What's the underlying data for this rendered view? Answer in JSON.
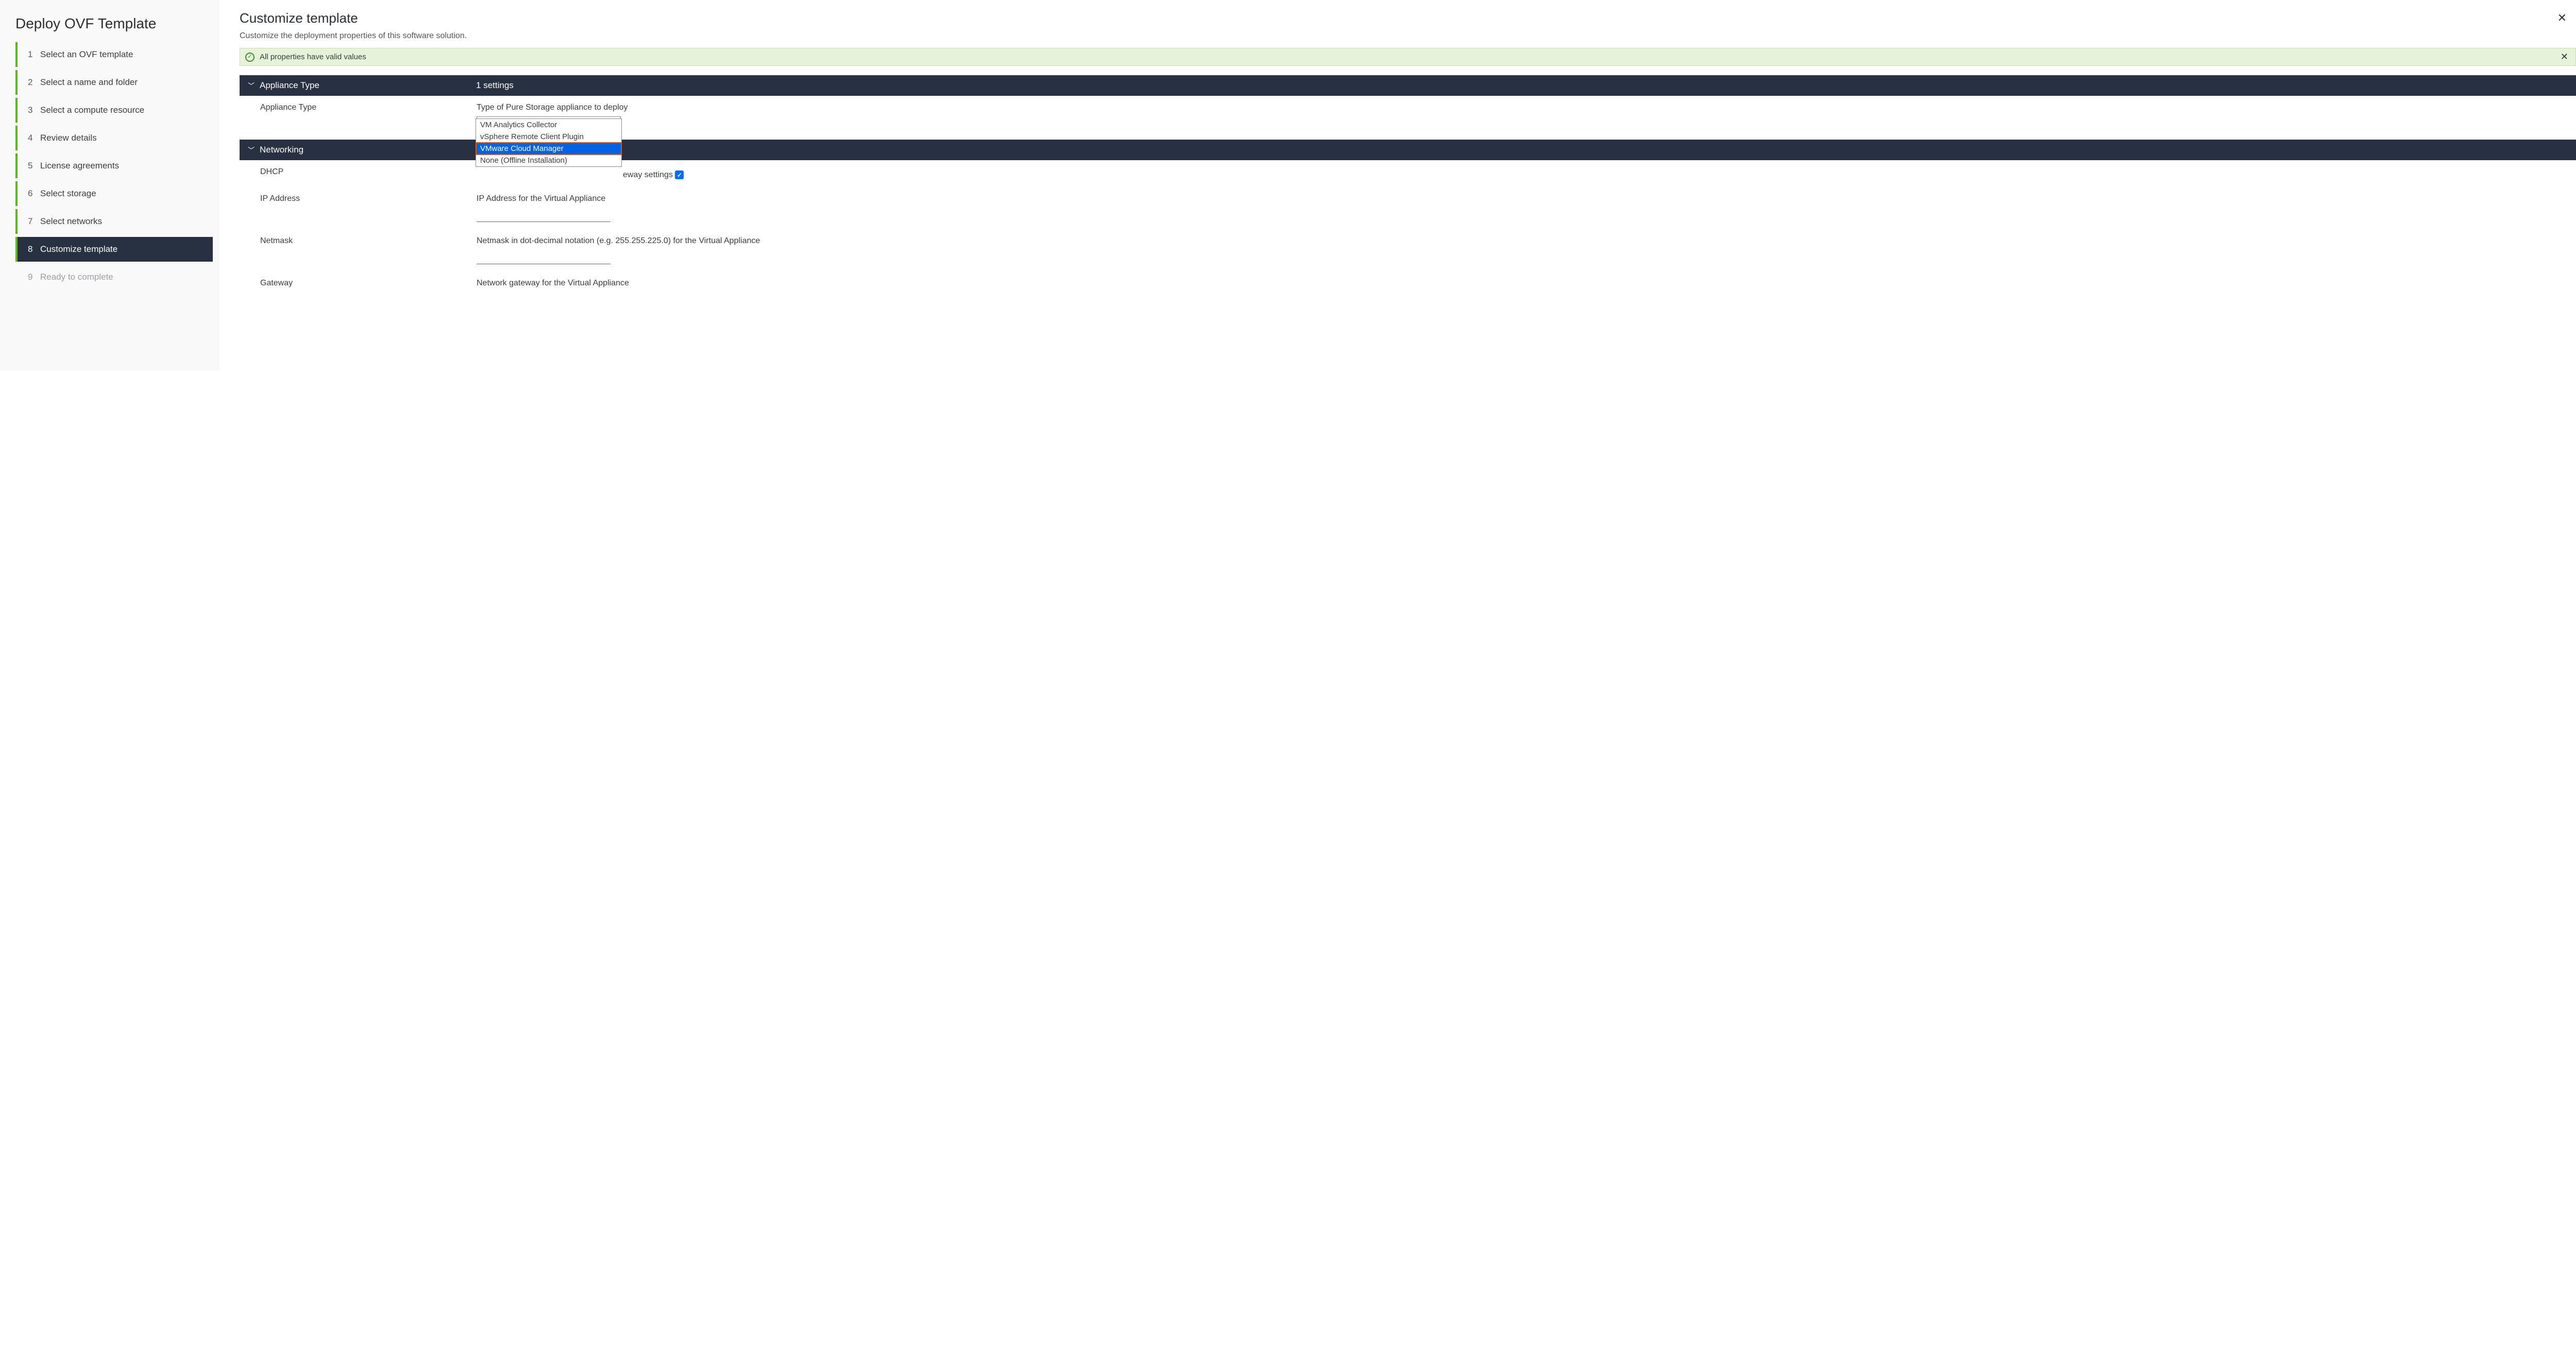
{
  "wizard": {
    "title": "Deploy OVF Template",
    "steps": [
      {
        "num": "1",
        "label": "Select an OVF template",
        "state": "done"
      },
      {
        "num": "2",
        "label": "Select a name and folder",
        "state": "done"
      },
      {
        "num": "3",
        "label": "Select a compute resource",
        "state": "done"
      },
      {
        "num": "4",
        "label": "Review details",
        "state": "done"
      },
      {
        "num": "5",
        "label": "License agreements",
        "state": "done"
      },
      {
        "num": "6",
        "label": "Select storage",
        "state": "done"
      },
      {
        "num": "7",
        "label": "Select networks",
        "state": "done"
      },
      {
        "num": "8",
        "label": "Customize template",
        "state": "active"
      },
      {
        "num": "9",
        "label": "Ready to complete",
        "state": "future"
      }
    ]
  },
  "main": {
    "title": "Customize template",
    "subtitle": "Customize the deployment properties of this software solution.",
    "banner_text": "All properties have valid values"
  },
  "sections": {
    "appliance": {
      "header": "Appliance Type",
      "count": "1 settings",
      "row_label": "Appliance Type",
      "row_desc": "Type of Pure Storage appliance to deploy",
      "selected": "VMware Cloud Manager",
      "options": [
        "VM Analytics Collector",
        "vSphere Remote Client Plugin",
        "VMware Cloud Manager",
        "None (Offline Installation)"
      ]
    },
    "networking": {
      "header": "Networking",
      "dhcp_label": "DHCP",
      "dhcp_desc_trail": "eway settings",
      "ip_label": "IP Address",
      "ip_desc": "IP Address for the Virtual Appliance",
      "netmask_label": "Netmask",
      "netmask_desc": "Netmask in dot-decimal notation (e.g. 255.255.225.0) for the Virtual Appliance",
      "gateway_label": "Gateway",
      "gateway_desc": "Network gateway for the Virtual Appliance"
    }
  }
}
